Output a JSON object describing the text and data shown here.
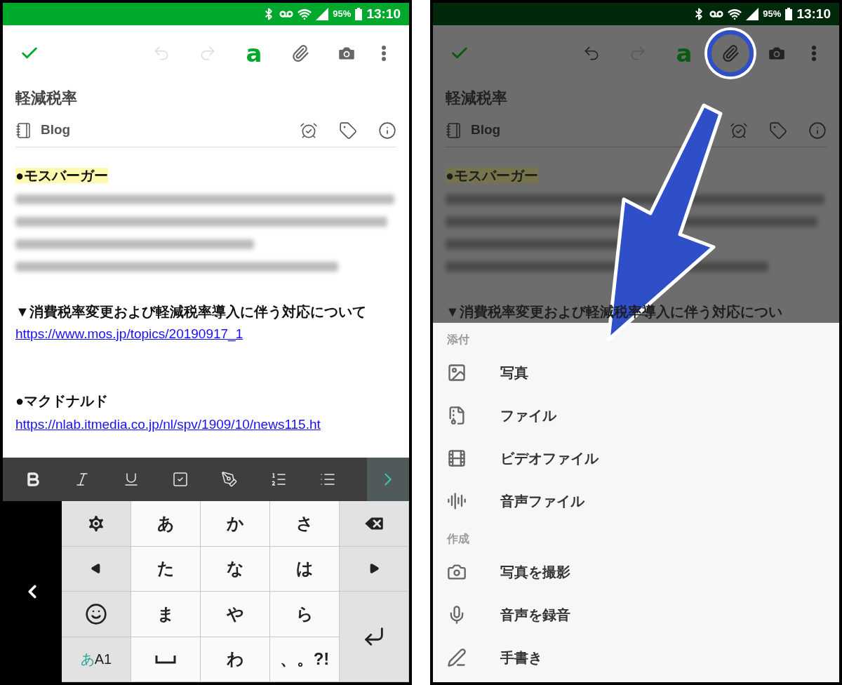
{
  "screens": [
    {
      "dimmed": false,
      "status_bar": {
        "battery": "95%",
        "time": "13:10"
      },
      "toolbar": {
        "undo_disabled": true,
        "redo_disabled": true,
        "format_label": "a",
        "attach_highlighted": false
      },
      "note": {
        "title": "軽減税率",
        "notebook": "Blog",
        "content": [
          {
            "kind": "heading",
            "text": "●モスバーガー",
            "highlighted": true,
            "space_before": false
          },
          {
            "kind": "blurred",
            "space_before": false
          },
          {
            "kind": "blurred",
            "space_before": false
          },
          {
            "kind": "blurred",
            "space_before": false
          },
          {
            "kind": "blurred",
            "space_before": false
          },
          {
            "kind": "text",
            "text": "▼消費税率変更および軽減税率導入に伴う対応について",
            "space_before": true
          },
          {
            "kind": "link",
            "text": "https://www.mos.jp/topics/20190917_1",
            "space_before": false
          },
          {
            "kind": "heading",
            "text": "●マクドナルド",
            "highlighted": false,
            "space_before": true
          },
          {
            "kind": "link",
            "text": "https://nlab.itmedia.co.jp/nl/spv/1909/10/news115.ht",
            "space_before": false
          }
        ]
      },
      "keyboard": {
        "keys": [
          {
            "kind": "settings"
          },
          {
            "kind": "char",
            "label": "あ"
          },
          {
            "kind": "char",
            "label": "か"
          },
          {
            "kind": "char",
            "label": "さ"
          },
          {
            "kind": "backspace"
          },
          {
            "kind": "left"
          },
          {
            "kind": "char",
            "label": "た"
          },
          {
            "kind": "char",
            "label": "な"
          },
          {
            "kind": "char",
            "label": "は"
          },
          {
            "kind": "right"
          },
          {
            "kind": "emoji"
          },
          {
            "kind": "char",
            "label": "ま"
          },
          {
            "kind": "char",
            "label": "や"
          },
          {
            "kind": "char",
            "label": "ら"
          },
          {
            "kind": "enter"
          },
          {
            "kind": "mode",
            "kana": "あ",
            "latin": "A1"
          },
          {
            "kind": "space"
          },
          {
            "kind": "char",
            "label": "わ"
          },
          {
            "kind": "char",
            "label": "、。?!"
          }
        ]
      }
    },
    {
      "dimmed": true,
      "status_bar": {
        "battery": "95%",
        "time": "13:10"
      },
      "toolbar": {
        "undo_disabled": false,
        "redo_disabled": true,
        "format_label": "a",
        "attach_highlighted": true
      },
      "note": {
        "title": "軽減税率",
        "notebook": "Blog",
        "content": [
          {
            "kind": "heading",
            "text": "●モスバーガー",
            "highlighted": true,
            "space_before": false
          },
          {
            "kind": "blurred",
            "space_before": false
          },
          {
            "kind": "blurred",
            "space_before": false
          },
          {
            "kind": "blurred",
            "space_before": false
          },
          {
            "kind": "blurred",
            "space_before": false
          },
          {
            "kind": "text",
            "text": "▼消費税率変更および軽減税率導入に伴う対応につい",
            "space_before": true
          }
        ]
      },
      "sheet": {
        "sections": [
          {
            "heading": "添付",
            "items": [
              {
                "label": "写真"
              },
              {
                "label": "ファイル"
              },
              {
                "label": "ビデオファイル"
              },
              {
                "label": "音声ファイル"
              }
            ]
          },
          {
            "heading": "作成",
            "items": [
              {
                "label": "写真を撮影"
              },
              {
                "label": "音声を録音"
              },
              {
                "label": "手書き"
              }
            ]
          }
        ]
      }
    }
  ]
}
